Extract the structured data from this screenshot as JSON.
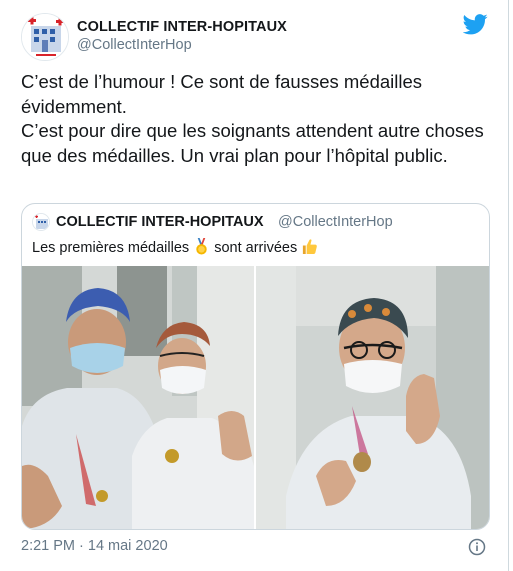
{
  "tweet": {
    "author": {
      "display_name": "COLLECTIF INTER-HOPITAUX",
      "handle": "@CollectInterHop"
    },
    "text": [
      "C’est de l’humour ! Ce sont de fausses médailles évidemment.",
      "C’est pour dire que les soignants attendent autre choses que des médailles. Un vrai plan pour l’hôpital public."
    ],
    "timestamp": "2:21 PM · 14 mai 2020"
  },
  "quoted": {
    "display_name": "COLLECTIF INTER-HOPITAUX",
    "handle": "@CollectInterHop",
    "text_before": "Les premières médailles",
    "text_middle": "sont arrivées",
    "emoji": [
      "medal-emoji",
      "thumbs-up-emoji"
    ]
  },
  "icons": [
    "twitter-bird-icon",
    "info-icon"
  ],
  "colors": {
    "twitter_blue": "#1da1f2",
    "handle_gray": "#657786",
    "border": "#ccd6dd",
    "text": "#14171a"
  }
}
